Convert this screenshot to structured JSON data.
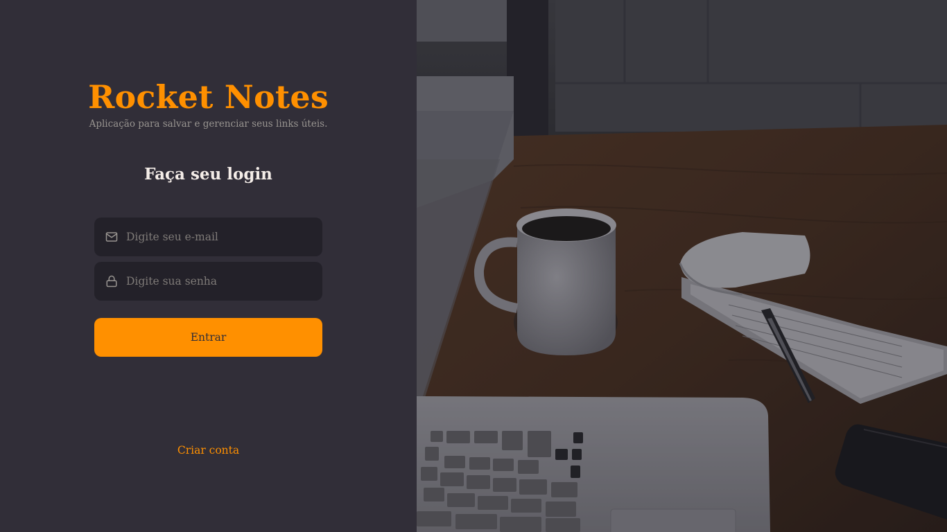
{
  "brand": {
    "title": "Rocket Notes",
    "subtitle": "Aplicação para salvar e gerenciar seus links úteis."
  },
  "form": {
    "heading": "Faça seu login",
    "email_placeholder": "Digite seu e-mail",
    "email_icon": "mail-icon",
    "password_placeholder": "Digite sua senha",
    "password_icon": "lock-icon",
    "submit_label": "Entrar"
  },
  "links": {
    "create_account": "Criar conta"
  },
  "colors": {
    "accent": "#ff9000",
    "background": "#312e38",
    "input_background": "#232129",
    "heading_text": "#f4ede8",
    "muted_text": "#999591"
  }
}
